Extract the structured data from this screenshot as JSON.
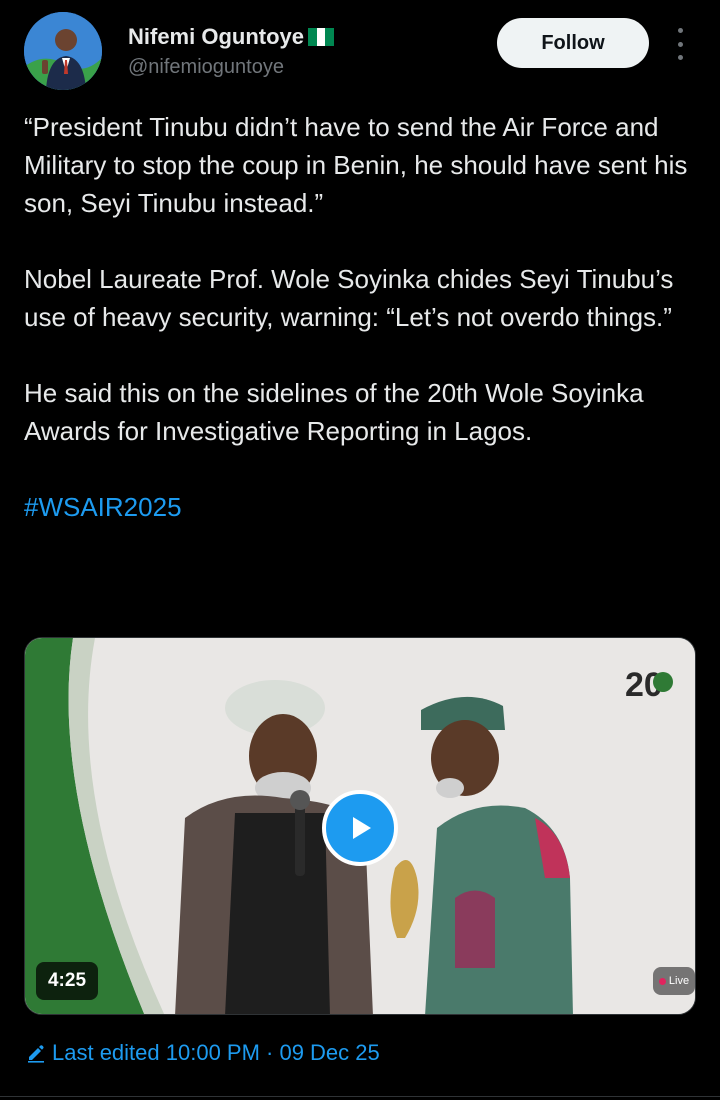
{
  "user": {
    "display_name": "Nifemi Oguntoye",
    "handle": "@nifemioguntoye",
    "flag_colors": [
      "#008751",
      "#ffffff",
      "#008751"
    ]
  },
  "actions": {
    "follow_label": "Follow",
    "more_icon": "more-vertical-icon"
  },
  "tweet": {
    "paragraphs": [
      "“President Tinubu didn’t have to send the Air Force and Military to stop the coup in Benin, he should have sent his son, Seyi Tinubu instead.”",
      "Nobel Laureate Prof. Wole Soyinka chides Seyi Tinubu’s use of heavy security, warning: “Let’s not overdo things.”",
      "He said this on the sidelines of the 20th Wole Soyinka Awards for Investigative Reporting in Lagos."
    ],
    "hashtag": "#WSAIR2025"
  },
  "media": {
    "type": "video",
    "duration": "4:25",
    "live_label": "Live",
    "corner_logo_text": "20",
    "play_icon": "play-icon"
  },
  "footer": {
    "edited_text": "Last edited 10:00 PM · 09 Dec 25",
    "edit_icon": "pencil-icon"
  },
  "colors": {
    "accent": "#1d9bf0",
    "background": "#000000",
    "text": "#e7e9ea",
    "muted": "#71767b"
  }
}
